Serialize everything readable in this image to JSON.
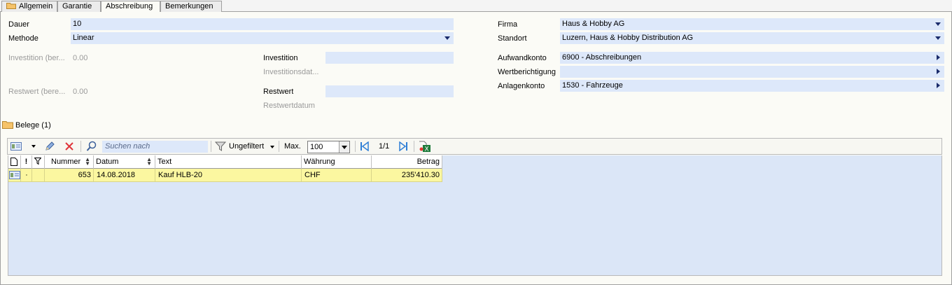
{
  "tabs": [
    {
      "label": "Allgemein"
    },
    {
      "label": "Garantie"
    },
    {
      "label": "Abschreibung"
    },
    {
      "label": "Bemerkungen"
    }
  ],
  "form": {
    "dauer_label": "Dauer",
    "dauer_value": "10",
    "methode_label": "Methode",
    "methode_value": "Linear",
    "investition_ber_label": "Investition (ber...",
    "investition_ber_value": "0.00",
    "restwert_ber_label": "Restwert (bere...",
    "restwert_ber_value": "0.00",
    "investition_label": "Investition",
    "investition_value": "",
    "investitionsdat_label": "Investitionsdat...",
    "restwert_label": "Restwert",
    "restwert_value": "",
    "restwertdatum_label": "Restwertdatum",
    "firma_label": "Firma",
    "firma_value": "Haus & Hobby AG",
    "standort_label": "Standort",
    "standort_value": "Luzern, Haus & Hobby Distribution AG",
    "aufwandkonto_label": "Aufwandkonto",
    "aufwandkonto_value": "6900  -  Abschreibungen",
    "wertberichtigung_label": "Wertberichtigung",
    "wertberichtigung_value": "",
    "anlagenkonto_label": "Anlagenkonto",
    "anlagenkonto_value": "1530  -  Fahrzeuge"
  },
  "belege": {
    "title": "Belege (1)",
    "toolbar": {
      "search_placeholder": "Suchen nach",
      "filter_label": "Ungefiltert",
      "max_label": "Max.",
      "max_value": "100",
      "page_indicator": "1/1"
    },
    "columns": [
      "Nummer",
      "Datum",
      "Text",
      "Währung",
      "Betrag"
    ],
    "rows": [
      {
        "nummer": "653",
        "datum": "14.08.2018",
        "text": "Kauf HLB-20",
        "waehrung": "CHF",
        "betrag": "235'410.30"
      }
    ]
  },
  "colors": {
    "field_bg": "#dde8fa",
    "row_highlight": "#fbf7a0",
    "arrow": "#1a2b6b"
  }
}
